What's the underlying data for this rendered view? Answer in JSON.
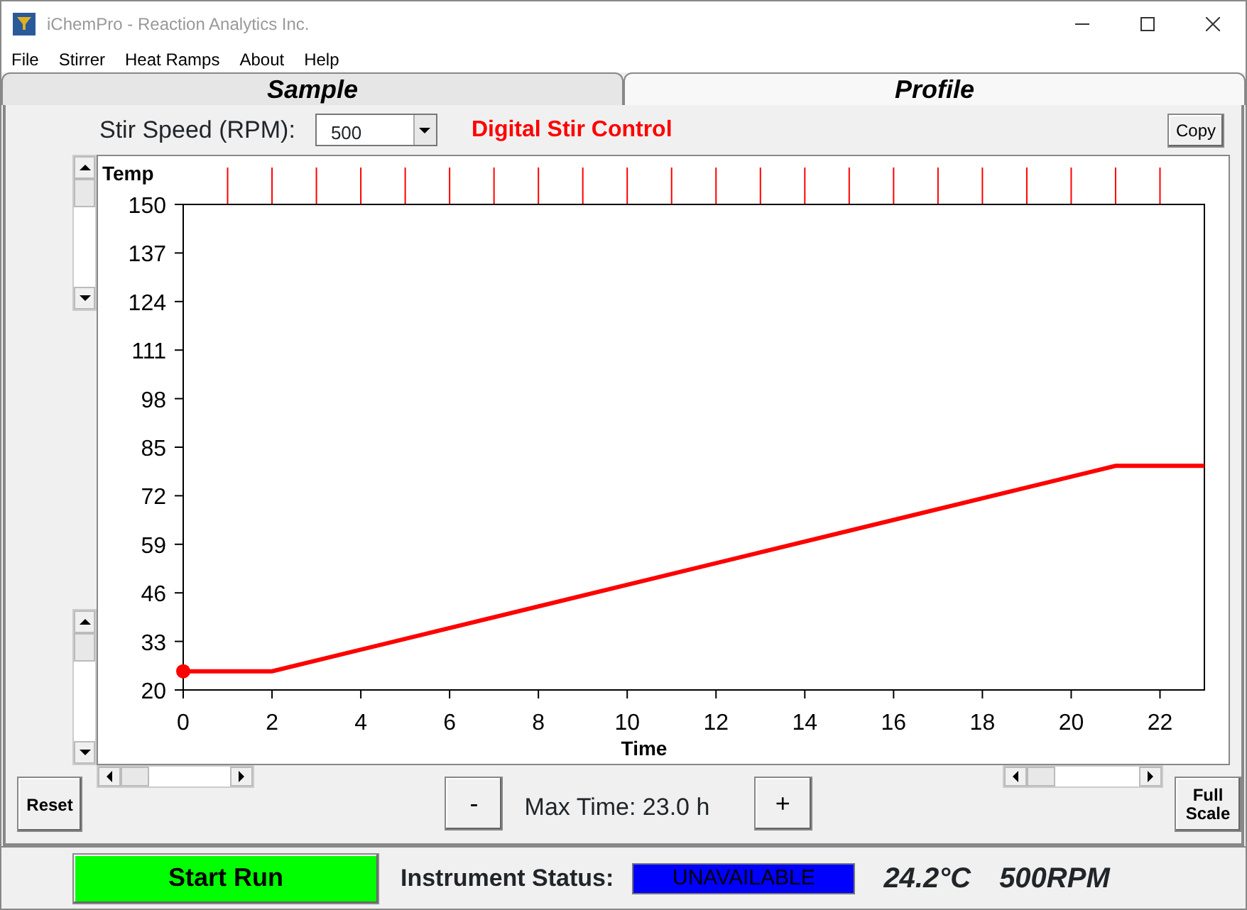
{
  "window": {
    "title": "iChemPro - Reaction Analytics Inc."
  },
  "menu": [
    "File",
    "Stirrer",
    "Heat Ramps",
    "About",
    "Help"
  ],
  "tabs": [
    {
      "label": "Sample",
      "selected": false
    },
    {
      "label": "Profile",
      "selected": true
    }
  ],
  "stir": {
    "label": "Stir Speed (RPM):",
    "value": "500",
    "mode": "Digital Stir Control"
  },
  "copy_button": "Copy",
  "chart_data": {
    "type": "line",
    "xlabel": "Time",
    "ylabel": "Temp",
    "x": [
      0,
      2,
      21,
      23
    ],
    "series": [
      {
        "color": "#ff0000",
        "values": [
          25,
          25,
          80,
          80
        ]
      }
    ],
    "xlim": [
      0,
      23
    ],
    "ylim": [
      20,
      150
    ],
    "xticks": [
      0,
      2,
      4,
      6,
      8,
      10,
      12,
      14,
      16,
      18,
      20,
      22
    ],
    "yticks": [
      20,
      33,
      46,
      59,
      72,
      85,
      98,
      111,
      124,
      137,
      150
    ]
  },
  "controls": {
    "reset": "Reset",
    "minus": "-",
    "max_time": "Max Time: 23.0 h",
    "plus": "+",
    "full_scale": "Full Scale"
  },
  "status_bar": {
    "start": "Start Run",
    "status_label": "Instrument Status:",
    "status_value": "UNAVAILABLE",
    "temperature": "24.2°C",
    "rpm": "500RPM"
  }
}
